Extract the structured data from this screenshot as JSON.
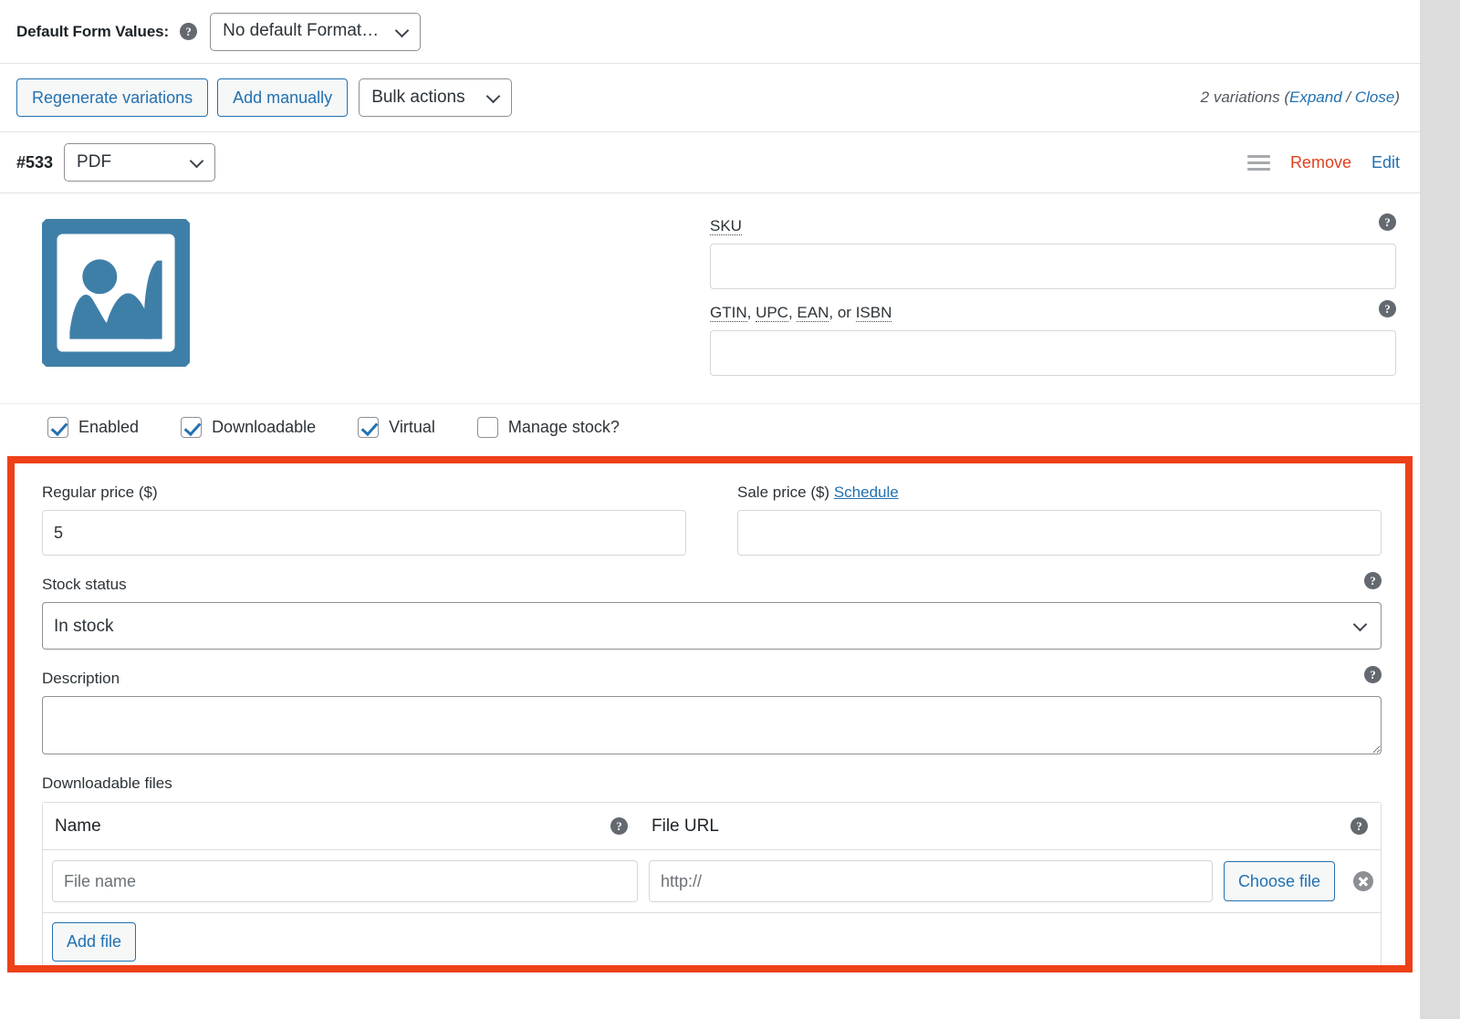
{
  "defaults_bar": {
    "label": "Default Form Values:",
    "help_icon": "help-icon",
    "select_value": "No default Format…"
  },
  "toolbar": {
    "regenerate_label": "Regenerate variations",
    "add_manually_label": "Add manually",
    "bulk_actions_label": "Bulk actions",
    "variations_count_text": "2 variations ",
    "paren_open": "(",
    "expand_label": "Expand",
    "separator": " / ",
    "close_label": "Close",
    "paren_close": ")"
  },
  "variation": {
    "id": "#533",
    "attribute_value": "PDF",
    "drag_handle": "drag-handle-icon",
    "remove_label": "Remove",
    "edit_label": "Edit",
    "thumbnail_icon": "image-placeholder-icon",
    "thumbnail_color": "#3e7fa8",
    "sku": {
      "label": "SKU",
      "value": "",
      "placeholder": ""
    },
    "gtin": {
      "label_parts": [
        "GTIN",
        ", ",
        "UPC",
        ", ",
        "EAN",
        ", or ",
        "ISBN"
      ],
      "value": "",
      "placeholder": ""
    },
    "checkboxes": [
      {
        "label": "Enabled",
        "checked": true
      },
      {
        "label": "Downloadable",
        "checked": true
      },
      {
        "label": "Virtual",
        "checked": true
      },
      {
        "label": "Manage stock?",
        "checked": false
      }
    ]
  },
  "highlight": {
    "border_color": "#ee4019",
    "regular_price": {
      "label": "Regular price ($)",
      "value": "5"
    },
    "sale_price": {
      "label": "Sale price ($) ",
      "schedule_label": "Schedule",
      "value": ""
    },
    "stock_status": {
      "label": "Stock status",
      "value": "In stock"
    },
    "description": {
      "label": "Description",
      "value": ""
    },
    "downloadable_files": {
      "label": "Downloadable files",
      "col_name": "Name",
      "col_url": "File URL",
      "rows": [
        {
          "name_value": "",
          "name_placeholder": "File name",
          "url_value": "",
          "url_placeholder": "http://",
          "choose_file_label": "Choose file",
          "delete_icon": "delete-circle-icon"
        }
      ],
      "add_file_label": "Add file"
    }
  }
}
